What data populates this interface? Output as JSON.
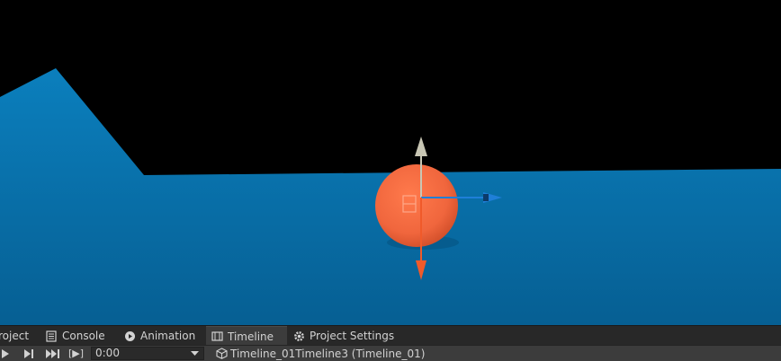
{
  "tabs": [
    {
      "label": "roject",
      "icon": "project-icon"
    },
    {
      "label": "Console",
      "icon": "console-icon"
    },
    {
      "label": "Animation",
      "icon": "animation-icon"
    },
    {
      "label": "Timeline",
      "icon": "timeline-icon",
      "active": true
    },
    {
      "label": "Project Settings",
      "icon": "gear-icon"
    }
  ],
  "toolbar": {
    "frame_mode_label": "[▶]",
    "time_value": "0:00",
    "breadcrumb": "Timeline_01Timeline3 (Timeline_01)"
  },
  "colors": {
    "sky": "#000000",
    "ground": "#0a79b4",
    "sphere": "#f0663d",
    "gizmo_y": "#c8c6b4",
    "gizmo_x": "#1f7fd8",
    "gizmo_neg": "#f05a2a",
    "panel_bg": "#282828",
    "toolbar_bg": "#3c3c3c"
  }
}
